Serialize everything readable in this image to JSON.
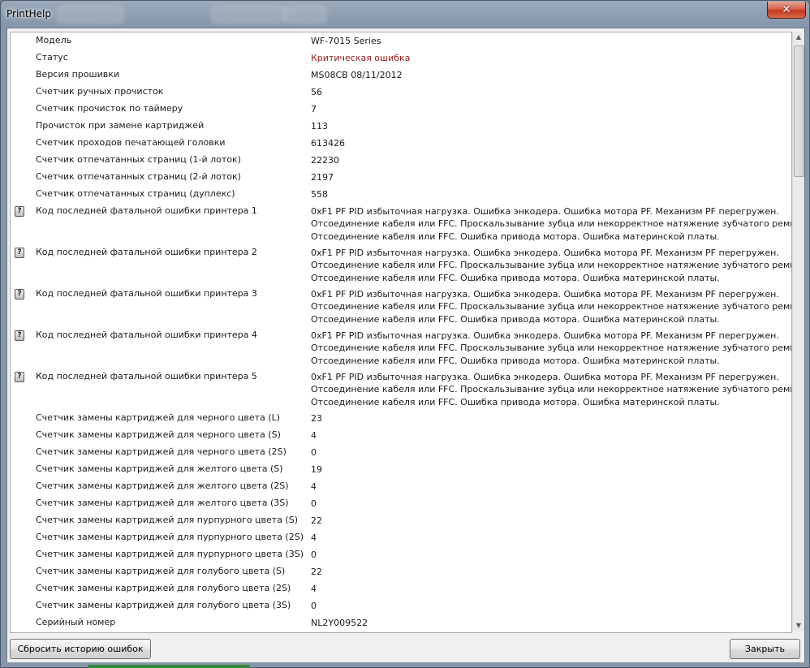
{
  "window": {
    "title": "PrintHelp",
    "close_symbol": "✕"
  },
  "rows": [
    {
      "label": "Модель",
      "value": "WF-7015 Series",
      "icon": false,
      "error": false
    },
    {
      "label": "Статус",
      "value": "Критическая ошибка",
      "icon": false,
      "error": true
    },
    {
      "label": "Версия прошивки",
      "value": "MS08CB 08/11/2012",
      "icon": false,
      "error": false
    },
    {
      "label": "Счетчик ручных прочисток",
      "value": "56",
      "icon": false,
      "error": false
    },
    {
      "label": "Счетчик прочисток по таймеру",
      "value": "7",
      "icon": false,
      "error": false
    },
    {
      "label": "Прочисток при замене картриджей",
      "value": "113",
      "icon": false,
      "error": false
    },
    {
      "label": "Счетчик проходов печатающей головки",
      "value": "613426",
      "icon": false,
      "error": false
    },
    {
      "label": "Счетчик отпечатанных страниц (1-й лоток)",
      "value": "22230",
      "icon": false,
      "error": false
    },
    {
      "label": "Счетчик отпечатанных страниц (2-й лоток)",
      "value": "2197",
      "icon": false,
      "error": false
    },
    {
      "label": "Счетчик отпечатанных страниц (дуплекс)",
      "value": "558",
      "icon": false,
      "error": false
    },
    {
      "label": "Код последней фатальной ошибки принтера 1",
      "value_lines": [
        "0xF1 PF PID избыточная нагрузка. Ошибка энкодера. Ошибка мотора PF. Механизм PF перегружен.",
        "Отсоединение кабеля или FFC. Проскальзывание зубца или некорректное натяжение зубчатого ремня.",
        "Отсоединение кабеля или FFC. Ошибка привода мотора. Ошибка материнской платы."
      ],
      "icon": true,
      "error": false
    },
    {
      "label": "Код последней фатальной ошибки принтера 2",
      "value_lines": [
        "0xF1 PF PID избыточная нагрузка. Ошибка энкодера. Ошибка мотора PF. Механизм PF перегружен.",
        "Отсоединение кабеля или FFC. Проскальзывание зубца или некорректное натяжение зубчатого ремня.",
        "Отсоединение кабеля или FFC. Ошибка привода мотора. Ошибка материнской платы."
      ],
      "icon": true,
      "error": false
    },
    {
      "label": "Код последней фатальной ошибки принтера 3",
      "value_lines": [
        "0xF1 PF PID избыточная нагрузка. Ошибка энкодера. Ошибка мотора PF. Механизм PF перегружен.",
        "Отсоединение кабеля или FFC. Проскальзывание зубца или некорректное натяжение зубчатого ремня.",
        "Отсоединение кабеля или FFC. Ошибка привода мотора. Ошибка материнской платы."
      ],
      "icon": true,
      "error": false
    },
    {
      "label": "Код последней фатальной ошибки принтера 4",
      "value_lines": [
        "0xF1 PF PID избыточная нагрузка. Ошибка энкодера. Ошибка мотора PF. Механизм PF перегружен.",
        "Отсоединение кабеля или FFC. Проскальзывание зубца или некорректное натяжение зубчатого ремня.",
        "Отсоединение кабеля или FFC. Ошибка привода мотора. Ошибка материнской платы."
      ],
      "icon": true,
      "error": false
    },
    {
      "label": "Код последней фатальной ошибки принтера 5",
      "value_lines": [
        "0xF1 PF PID избыточная нагрузка. Ошибка энкодера. Ошибка мотора PF. Механизм PF перегружен.",
        "Отсоединение кабеля или FFC. Проскальзывание зубца или некорректное натяжение зубчатого ремня.",
        "Отсоединение кабеля или FFC. Ошибка привода мотора. Ошибка материнской платы."
      ],
      "icon": true,
      "error": false
    },
    {
      "label": "Счетчик замены картриджей для черного цвета (L)",
      "value": "23",
      "icon": false,
      "error": false
    },
    {
      "label": "Счетчик замены картриджей для черного цвета (S)",
      "value": "4",
      "icon": false,
      "error": false
    },
    {
      "label": "Счетчик замены картриджей для черного цвета (2S)",
      "value": "0",
      "icon": false,
      "error": false
    },
    {
      "label": "Счетчик замены картриджей для желтого цвета (S)",
      "value": "19",
      "icon": false,
      "error": false
    },
    {
      "label": "Счетчик замены картриджей для желтого цвета (2S)",
      "value": "4",
      "icon": false,
      "error": false
    },
    {
      "label": "Счетчик замены картриджей для желтого цвета (3S)",
      "value": "0",
      "icon": false,
      "error": false
    },
    {
      "label": "Счетчик замены картриджей для пурпурного цвета (S)",
      "value": "22",
      "icon": false,
      "error": false
    },
    {
      "label": "Счетчик замены картриджей для пурпурного цвета (2S)",
      "value": "4",
      "icon": false,
      "error": false
    },
    {
      "label": "Счетчик замены картриджей для пурпурного цвета (3S)",
      "value": "0",
      "icon": false,
      "error": false
    },
    {
      "label": "Счетчик замены картриджей для голубого цвета (S)",
      "value": "22",
      "icon": false,
      "error": false
    },
    {
      "label": "Счетчик замены картриджей для голубого цвета (2S)",
      "value": "4",
      "icon": false,
      "error": false
    },
    {
      "label": "Счетчик замены картриджей для голубого цвета (3S)",
      "value": "0",
      "icon": false,
      "error": false
    },
    {
      "label": "Серийный номер",
      "value": "NL2Y009522",
      "icon": false,
      "error": false
    }
  ],
  "help_icon_glyph": "?",
  "colors": {
    "error_text": "#9a1b1b"
  },
  "buttons": {
    "reset_label": "Сбросить историю ошибок",
    "close_label": "Закрыть"
  }
}
